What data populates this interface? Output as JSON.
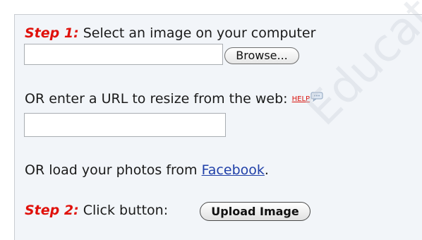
{
  "step1": {
    "label": "Step 1:",
    "text": " Select an image on your computer",
    "browse_label": "Browse..."
  },
  "url": {
    "text": "OR enter a URL to resize from the web: ",
    "help_label": "HELP",
    "value": "",
    "help_icon": "speech-bubble-icon"
  },
  "facebook": {
    "prefix": "OR load your photos from ",
    "link": "Facebook",
    "suffix": "."
  },
  "step2": {
    "label": "Step 2:",
    "text": " Click button: ",
    "upload_label": "Upload Image"
  },
  "watermark": "Educati",
  "colors": {
    "step_red": "#e0110b",
    "link_blue": "#1f3fa8",
    "panel_bg": "#f2f5f9"
  }
}
